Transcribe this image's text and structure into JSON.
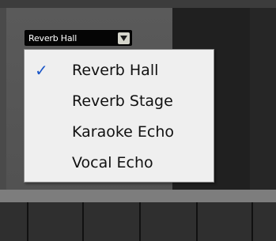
{
  "preset_dropdown": {
    "selected": "Reverb Hall",
    "arrow_icon": "chevron-down-icon"
  },
  "menu": {
    "items": [
      {
        "label": "Reverb Hall",
        "checked": true
      },
      {
        "label": "Reverb Stage",
        "checked": false
      },
      {
        "label": "Karaoke Echo",
        "checked": false
      },
      {
        "label": "Vocal Echo",
        "checked": false
      }
    ],
    "check_glyph": "✓",
    "check_icon": "checkmark-icon"
  },
  "colors": {
    "check": "#1a56c8",
    "menu_bg": "#efefef",
    "dropdown_bg": "#050505"
  }
}
